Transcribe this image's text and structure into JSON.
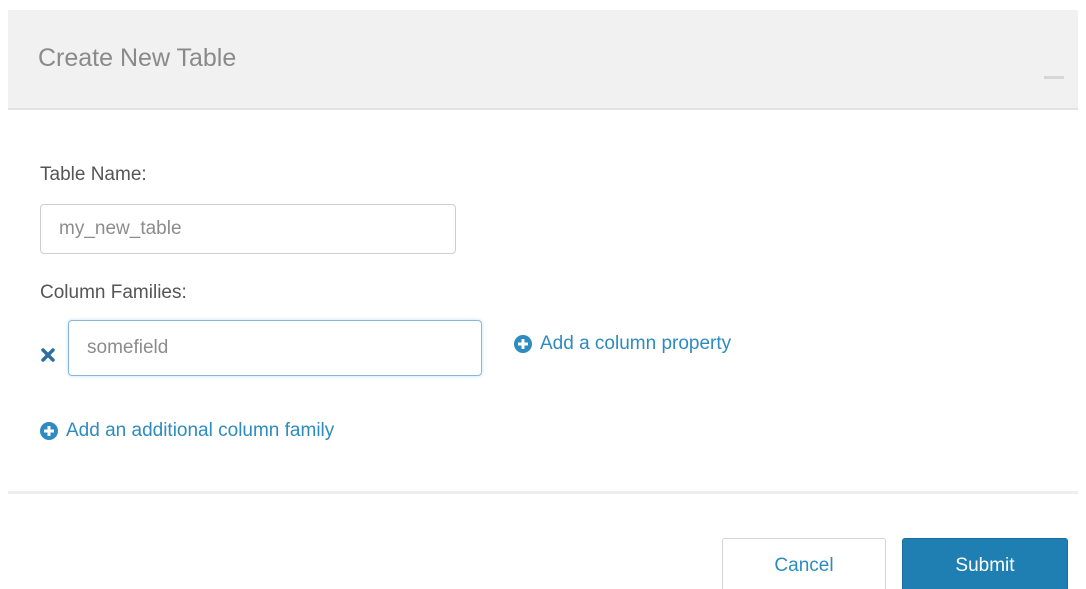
{
  "dialog": {
    "title": "Create New Table"
  },
  "form": {
    "table_name_label": "Table Name:",
    "table_name_value": "my_new_table",
    "column_families_label": "Column Families:",
    "column_family_value": "somefield",
    "add_column_property": "Add a column property",
    "add_column_family": "Add an additional column family"
  },
  "footer": {
    "cancel_label": "Cancel",
    "submit_label": "Submit"
  },
  "colors": {
    "accent": "#2e8bbf",
    "primary_button": "#1f7fb3",
    "header_bg": "#f1f1f1"
  },
  "icons": {
    "remove": "times-icon",
    "add": "plus-circle-icon",
    "close": "close-icon"
  }
}
